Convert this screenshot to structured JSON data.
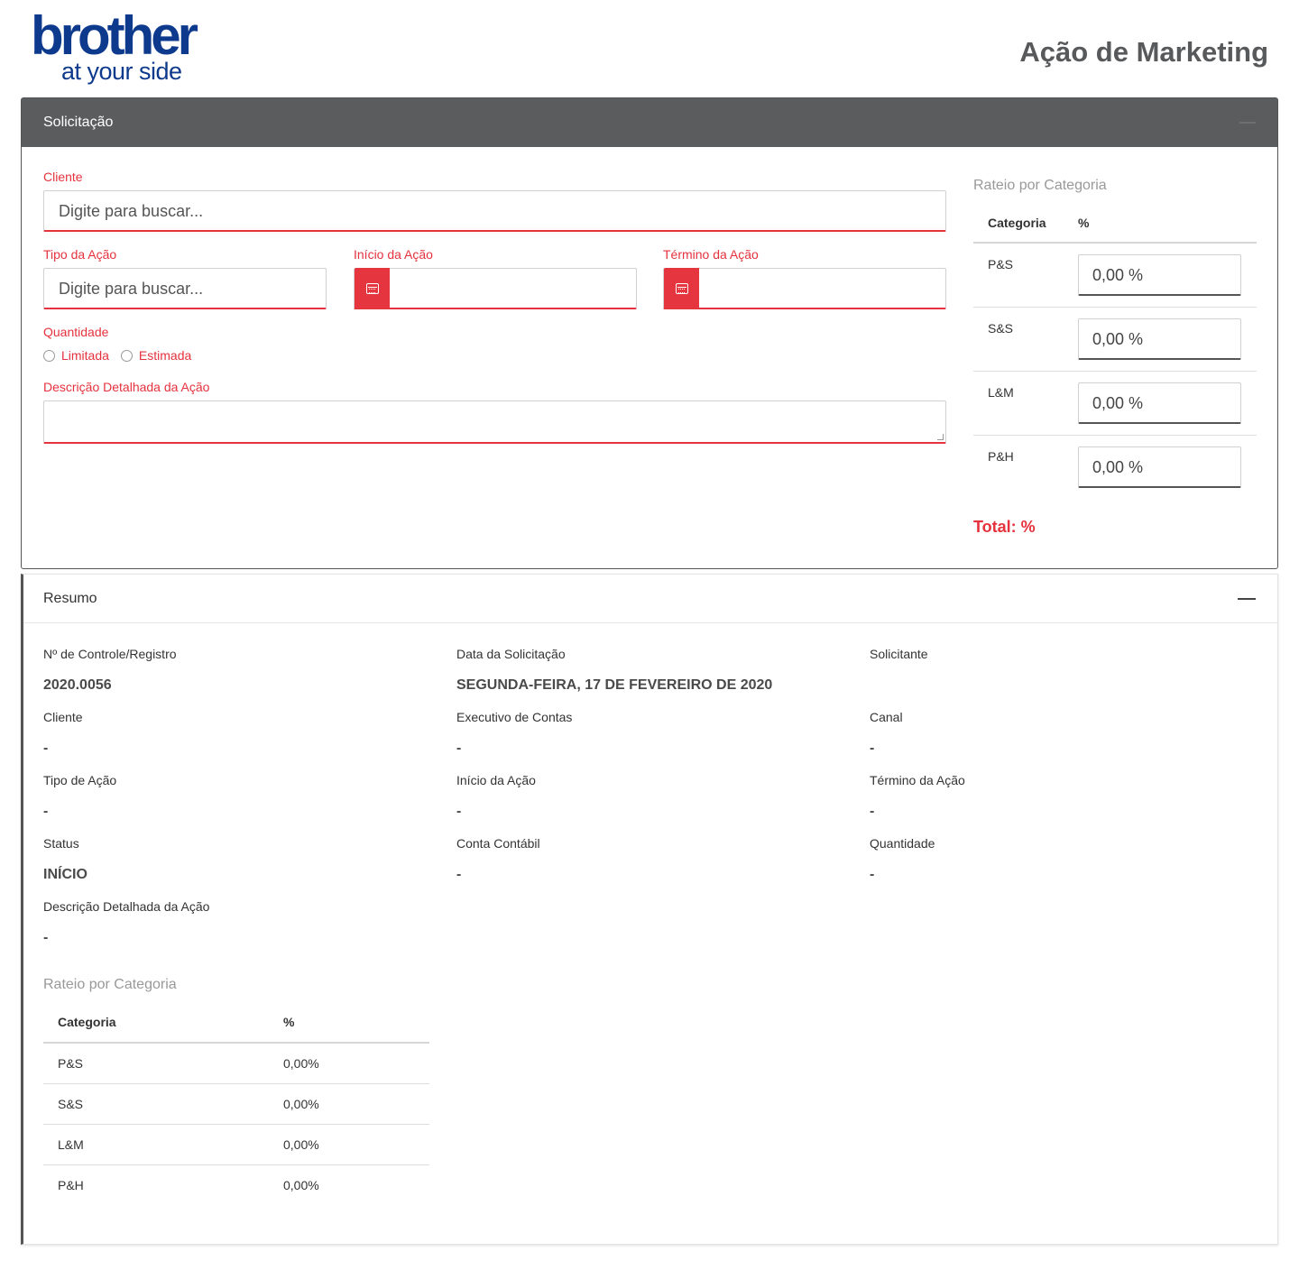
{
  "header": {
    "logo_main": "brother",
    "logo_sub": "at your side",
    "title": "Ação de Marketing"
  },
  "solicitacao": {
    "title": "Solicitação",
    "cliente_label": "Cliente",
    "cliente_placeholder": "Digite para buscar...",
    "tipo_label": "Tipo da Ação",
    "tipo_placeholder": "Digite para buscar...",
    "inicio_label": "Início da Ação",
    "termino_label": "Término da Ação",
    "quantidade_label": "Quantidade",
    "quantidade_options": [
      "Limitada",
      "Estimada"
    ],
    "descricao_label": "Descrição Detalhada da Ação",
    "rateio": {
      "title": "Rateio por Categoria",
      "col_categoria": "Categoria",
      "col_pct": "%",
      "rows": [
        {
          "cat": "P&S",
          "value": "0,00 %"
        },
        {
          "cat": "S&S",
          "value": "0,00 %"
        },
        {
          "cat": "L&M",
          "value": "0,00 %"
        },
        {
          "cat": "P&H",
          "value": "0,00 %"
        }
      ],
      "total": "Total: %"
    }
  },
  "resumo": {
    "title": "Resumo",
    "fields": [
      {
        "label": "Nº de Controle/Registro",
        "value": "2020.0056"
      },
      {
        "label": "Data da Solicitação",
        "value": "SEGUNDA-FEIRA, 17 DE FEVEREIRO DE 2020"
      },
      {
        "label": "Solicitante",
        "value": ""
      },
      {
        "label": "Cliente",
        "value": "-"
      },
      {
        "label": "Executivo de Contas",
        "value": "-"
      },
      {
        "label": "Canal",
        "value": "-"
      },
      {
        "label": "Tipo de Ação",
        "value": "-"
      },
      {
        "label": "Início da Ação",
        "value": "-"
      },
      {
        "label": "Término da Ação",
        "value": "-"
      },
      {
        "label": "Status",
        "value": "INÍCIO"
      },
      {
        "label": "Conta Contábil",
        "value": "-"
      },
      {
        "label": "Quantidade",
        "value": "-"
      },
      {
        "label": "Descrição Detalhada da Ação",
        "value": "-"
      }
    ],
    "rateio": {
      "title": "Rateio por Categoria",
      "col_categoria": "Categoria",
      "col_pct": "%",
      "rows": [
        {
          "cat": "P&S",
          "value": "0,00%"
        },
        {
          "cat": "S&S",
          "value": "0,00%"
        },
        {
          "cat": "L&M",
          "value": "0,00%"
        },
        {
          "cat": "P&H",
          "value": "0,00%"
        }
      ]
    }
  },
  "colors": {
    "accent_red": "#e5323d",
    "header_gray": "#5b5c5e",
    "brand_blue": "#0d3a8c"
  },
  "icons": [
    "calendar-icon",
    "collapse-icon"
  ]
}
